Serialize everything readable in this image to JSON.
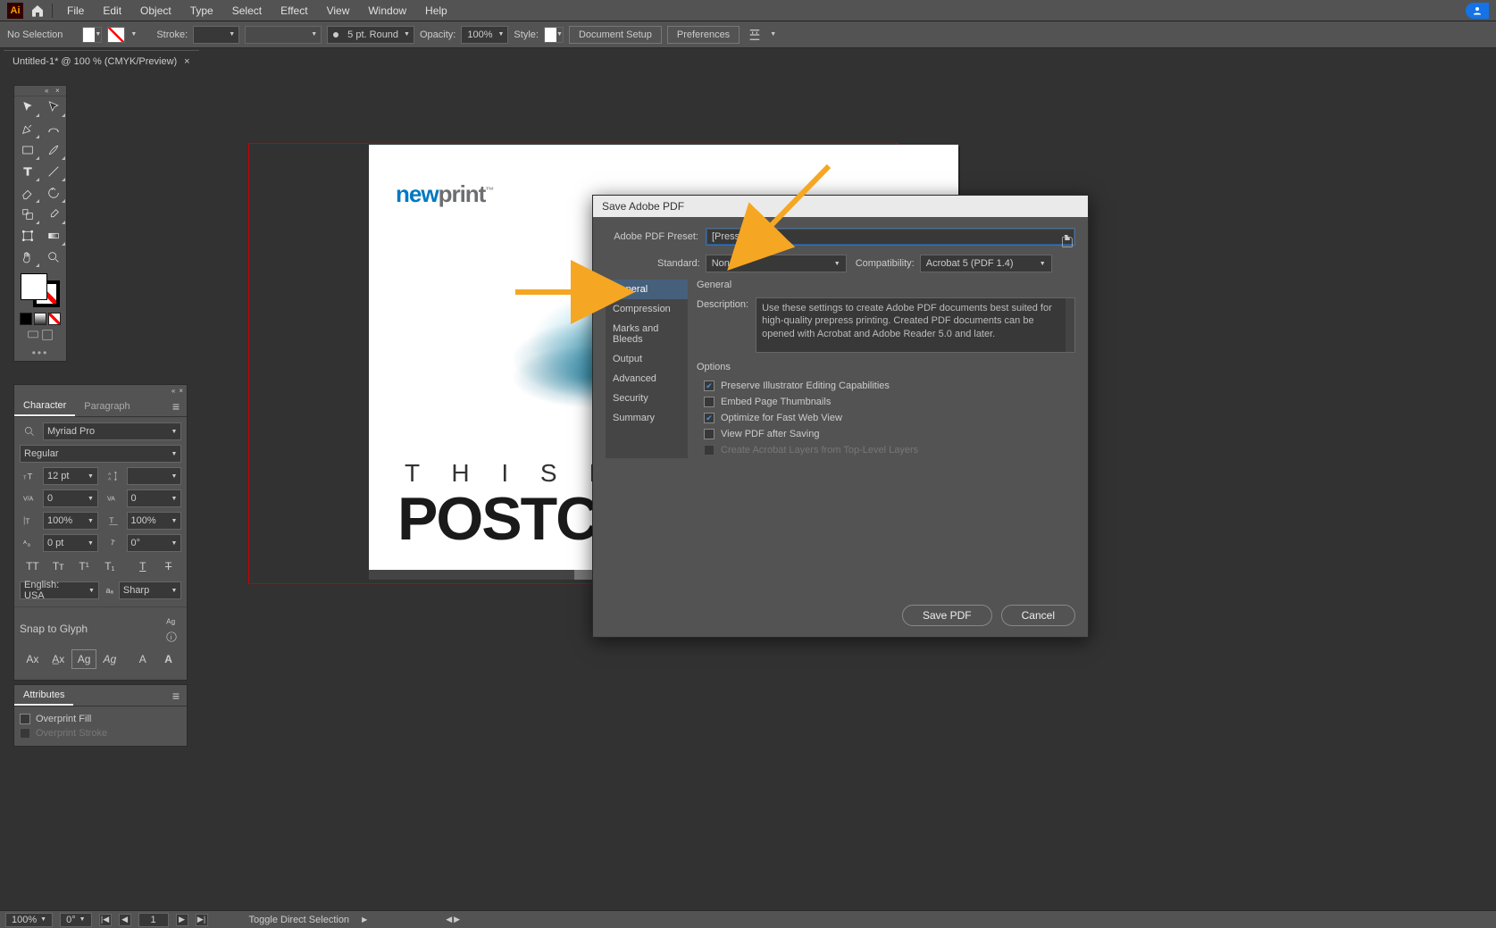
{
  "menu": {
    "items": [
      "File",
      "Edit",
      "Object",
      "Type",
      "Select",
      "Effect",
      "View",
      "Window",
      "Help"
    ]
  },
  "control": {
    "selection": "No Selection",
    "stroke_label": "Stroke:",
    "strokewt": "",
    "brush": "5 pt. Round",
    "opacity_label": "Opacity:",
    "opacity": "100%",
    "style_label": "Style:",
    "docsetup": "Document Setup",
    "prefs": "Preferences"
  },
  "doctab": {
    "title": "Untitled-1* @ 100 % (CMYK/Preview)"
  },
  "char_panel": {
    "tab1": "Character",
    "tab2": "Paragraph",
    "font": "Myriad Pro",
    "style": "Regular",
    "size": "12 pt",
    "leading": "",
    "kern": "0",
    "track": "0",
    "hscale": "100%",
    "vscale": "100%",
    "baseline": "0 pt",
    "rot": "0°",
    "lang": "English: USA",
    "aa": "Sharp",
    "snap": "Snap to Glyph"
  },
  "attr_panel": {
    "title": "Attributes",
    "of": "Overprint Fill",
    "os": "Overprint Stroke"
  },
  "artboard": {
    "logo_new": "new",
    "logo_print": "print",
    "line1": "T H I S   I S   A",
    "line2": "POSTCA"
  },
  "dialog": {
    "title": "Save Adobe PDF",
    "preset_label": "Adobe PDF Preset:",
    "preset": "[Press Quality]",
    "standard_label": "Standard:",
    "standard": "None",
    "compat_label": "Compatibility:",
    "compat": "Acrobat 5 (PDF 1.4)",
    "cats": [
      "General",
      "Compression",
      "Marks and Bleeds",
      "Output",
      "Advanced",
      "Security",
      "Summary"
    ],
    "section": "General",
    "desc_label": "Description:",
    "desc": "Use these settings to create Adobe PDF documents best suited for high-quality prepress printing.  Created PDF documents can be opened with Acrobat and Adobe Reader 5.0 and later.",
    "options": "Options",
    "opt1": "Preserve Illustrator Editing Capabilities",
    "opt2": "Embed Page Thumbnails",
    "opt3": "Optimize for Fast Web View",
    "opt4": "View PDF after Saving",
    "opt5": "Create Acrobat Layers from Top-Level Layers",
    "save": "Save PDF",
    "cancel": "Cancel"
  },
  "status": {
    "zoom": "100%",
    "rot": "0°",
    "art": "1",
    "hint": "Toggle Direct Selection"
  }
}
